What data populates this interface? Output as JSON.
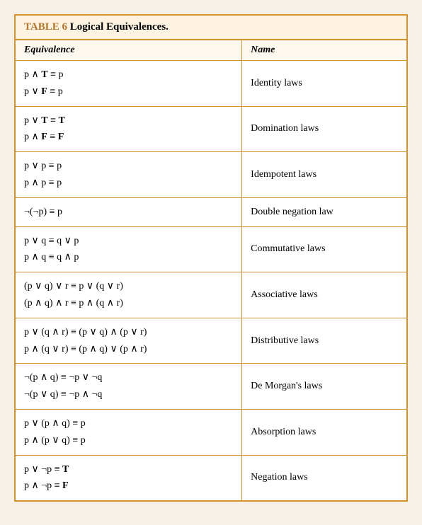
{
  "table": {
    "number": "TABLE 6",
    "title": "Logical Equivalences.",
    "col_eq": "Equivalence",
    "col_name": "Name",
    "rows": [
      {
        "eq_line1": "p ∧ T ≡ p",
        "eq_line2": "p ∨ F ≡ p",
        "eq_bold1": [
          "T"
        ],
        "eq_bold2": [
          "F"
        ],
        "name": "Identity laws"
      },
      {
        "eq_line1": "p ∨ T ≡ T",
        "eq_line2": "p ∧ F ≡ F",
        "eq_bold1": [
          "T",
          "T"
        ],
        "eq_bold2": [
          "F",
          "F"
        ],
        "name": "Domination laws"
      },
      {
        "eq_line1": "p ∨ p ≡ p",
        "eq_line2": "p ∧ p ≡ p",
        "name": "Idempotent laws"
      },
      {
        "eq_line1": "¬(¬p) ≡ p",
        "eq_line2": "",
        "name": "Double negation law"
      },
      {
        "eq_line1": "p ∨ q ≡ q ∨ p",
        "eq_line2": "p ∧ q ≡ q ∧ p",
        "name": "Commutative laws"
      },
      {
        "eq_line1": "(p ∨ q) ∨ r ≡ p ∨ (q ∨ r)",
        "eq_line2": "(p ∧ q) ∧ r ≡ p ∧ (q ∧ r)",
        "name": "Associative laws"
      },
      {
        "eq_line1": "p ∨ (q ∧ r) ≡ (p ∨ q) ∧ (p ∨ r)",
        "eq_line2": "p ∧ (q ∨ r) ≡ (p ∧ q) ∨ (p ∧ r)",
        "name": "Distributive laws"
      },
      {
        "eq_line1": "¬(p ∧ q) ≡ ¬p ∨ ¬q",
        "eq_line2": "¬(p ∨ q) ≡ ¬p ∧ ¬q",
        "name": "De Morgan’s laws"
      },
      {
        "eq_line1": "p ∨ (p ∧ q) ≡ p",
        "eq_line2": "p ∧ (p ∨ q) ≡ p",
        "name": "Absorption laws"
      },
      {
        "eq_line1": "p ∨ ¬p ≡ T",
        "eq_line2": "p ∧ ¬p ≡ F",
        "eq_bold1_t": true,
        "eq_bold2_f": true,
        "name": "Negation laws"
      }
    ]
  }
}
